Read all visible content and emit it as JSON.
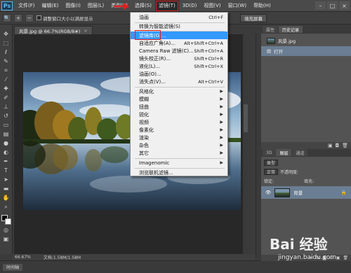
{
  "app": {
    "logo": "Ps"
  },
  "menubar": {
    "items": [
      "文件(F)",
      "编辑(E)",
      "图像(I)",
      "图层(L)",
      "类型(Y)",
      "选择(S)",
      "滤镜(T)",
      "3D(D)",
      "视图(V)",
      "窗口(W)",
      "帮助(H)"
    ],
    "active_index": 6,
    "window_controls": [
      "–",
      "□",
      "×"
    ]
  },
  "options_bar": {
    "checkbox_label": "调整窗口大小以满屏显示",
    "fill_screen_label": "填充屏幕"
  },
  "document": {
    "tab_title": "风景.jpg @ 66.7%(RGB/8#)",
    "tab_close": "×"
  },
  "status": {
    "zoom": "66.67%",
    "doc_info": "文档:1.58M/1.58M"
  },
  "timeline": {
    "tab_label": "时间轴"
  },
  "filter_menu": {
    "items": [
      {
        "label": "油画",
        "shortcut": "Ctrl+F"
      },
      {
        "label": "转换为智能滤镜(S)",
        "shortcut": ""
      },
      {
        "label": "滤镜库(G)...",
        "shortcut": "",
        "highlighted": true
      },
      {
        "label": "自适应广角(A)...",
        "shortcut": "Alt+Shift+Ctrl+A"
      },
      {
        "label": "Camera Raw 滤镜(C)...",
        "shortcut": "Shift+Ctrl+A"
      },
      {
        "label": "镜头校正(R)...",
        "shortcut": "Shift+Ctrl+R"
      },
      {
        "label": "液化(L)...",
        "shortcut": "Shift+Ctrl+X"
      },
      {
        "label": "油画(O)...",
        "shortcut": ""
      },
      {
        "label": "消失点(V)...",
        "shortcut": "Alt+Ctrl+V"
      },
      {
        "label": "风格化",
        "submenu": true
      },
      {
        "label": "模糊",
        "submenu": true
      },
      {
        "label": "扭曲",
        "submenu": true
      },
      {
        "label": "锐化",
        "submenu": true
      },
      {
        "label": "视频",
        "submenu": true
      },
      {
        "label": "像素化",
        "submenu": true
      },
      {
        "label": "渲染",
        "submenu": true
      },
      {
        "label": "杂色",
        "submenu": true
      },
      {
        "label": "其它",
        "submenu": true
      },
      {
        "label": "Imagenomic",
        "submenu": true
      },
      {
        "label": "浏览联机滤镜...",
        "shortcut": ""
      }
    ]
  },
  "history_panel": {
    "tabs": [
      "属性",
      "历史记录"
    ],
    "snapshot": "风景.jpg",
    "step": "打开"
  },
  "layers_panel": {
    "tabs": [
      "3D",
      "图层",
      "通道"
    ],
    "kind_filter": "类型",
    "blend_mode": "正常",
    "opacity_label": "不透明度:",
    "lock_label": "锁定:",
    "fill_label": "填充:",
    "layer_name": "背景"
  },
  "watermark": {
    "text": "Bai 经验",
    "url": "jingyan.baidu.com"
  },
  "colors": {
    "highlight": "#3399ff",
    "annotation_red": "#e02020",
    "dark_bg": "#3b3b3b"
  }
}
